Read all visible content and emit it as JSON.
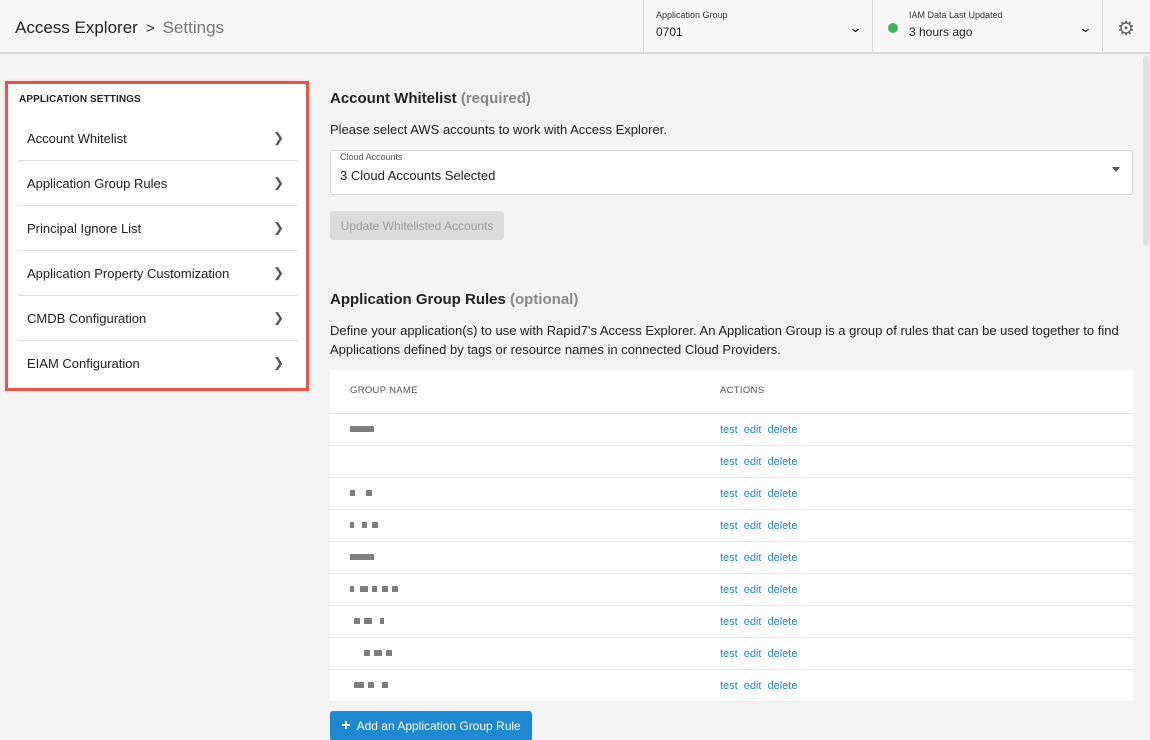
{
  "header": {
    "breadcrumb": {
      "app": "Access Explorer",
      "separator": ">",
      "page": "Settings"
    },
    "application_group": {
      "label": "Application Group",
      "value": "0701"
    },
    "iam_status": {
      "label": "IAM Data Last Updated",
      "value": "3 hours ago",
      "status_color": "#3db35a"
    },
    "icons": {
      "group_chevron": "chevron-down-icon",
      "iam_chevron": "chevron-down-icon",
      "settings": "gear-icon"
    }
  },
  "sidebar": {
    "heading": "APPLICATION SETTINGS",
    "highlight_color": "#ef5146",
    "items": [
      {
        "label": "Account Whitelist"
      },
      {
        "label": "Application Group Rules"
      },
      {
        "label": "Principal Ignore List"
      },
      {
        "label": "Application Property Customization"
      },
      {
        "label": "CMDB Configuration"
      },
      {
        "label": "EIAM Configuration"
      }
    ]
  },
  "account_whitelist": {
    "title": "Account Whitelist",
    "qualifier": "(required)",
    "description": "Please select AWS accounts to work with Access Explorer.",
    "select": {
      "label": "Cloud Accounts",
      "value": "3 Cloud Accounts Selected"
    },
    "update_button": "Update Whitelisted Accounts"
  },
  "application_group_rules": {
    "title": "Application Group Rules",
    "qualifier": "(optional)",
    "description": "Define your application(s) to use with Rapid7's Access Explorer. An Application Group is a group of rules that can be used together to find Applications defined by tags or resource names in connected Cloud Providers.",
    "columns": [
      "GROUP NAME",
      "ACTIONS"
    ],
    "row_actions": [
      "test",
      "edit",
      "delete"
    ],
    "row_count": 9,
    "add_button": "Add an Application Group Rule"
  },
  "colors": {
    "link": "#1f8ac9",
    "primary_button": "#1e88d0"
  }
}
